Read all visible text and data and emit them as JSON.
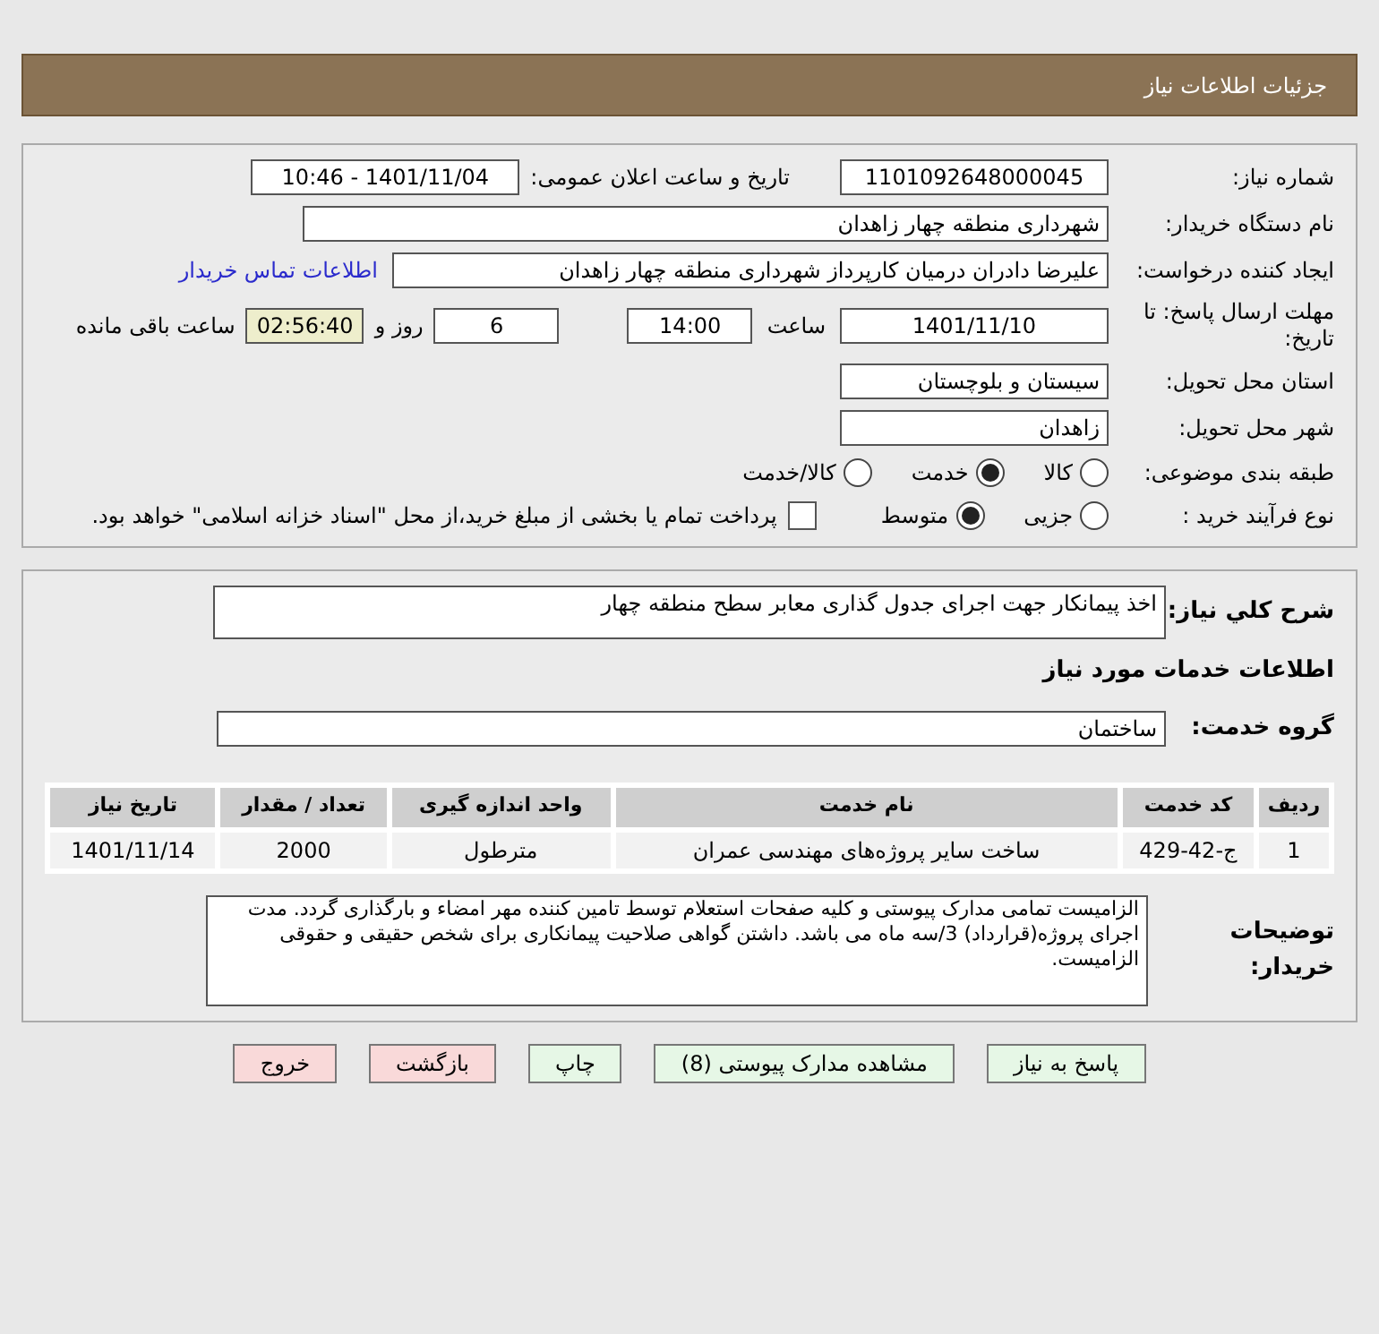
{
  "header": {
    "title": "جزئیات اطلاعات نیاز"
  },
  "info": {
    "need_number": {
      "label": "شماره نیاز:",
      "value": "1101092648000045"
    },
    "announce": {
      "label": "تاریخ و ساعت اعلان عمومی:",
      "value": "1401/11/04 - 10:46"
    },
    "buyer_org": {
      "label": "نام دستگاه خریدار:",
      "value": "شهرداری منطقه چهار زاهدان"
    },
    "requester": {
      "label": "ایجاد کننده درخواست:",
      "value": "علیرضا دادران درمیان کارپرداز شهرداری منطقه چهار زاهدان",
      "link": "اطلاعات تماس خریدار"
    },
    "deadline": {
      "label": "مهلت ارسال پاسخ: تا تاریخ:",
      "date": "1401/11/10",
      "time_label": "ساعت",
      "time": "14:00",
      "days": "6",
      "days_label": "روز و",
      "remaining": "02:56:40",
      "remaining_label": "ساعت باقی مانده"
    },
    "province": {
      "label": "استان محل تحویل:",
      "value": "سیستان و بلوچستان"
    },
    "city": {
      "label": "شهر محل تحویل:",
      "value": "زاهدان"
    },
    "category": {
      "label": "طبقه بندی موضوعی:",
      "options": [
        {
          "label": "کالا",
          "selected": false
        },
        {
          "label": "خدمت",
          "selected": true
        },
        {
          "label": "کالا/خدمت",
          "selected": false
        }
      ]
    },
    "process": {
      "label": "نوع فرآیند خرید :",
      "options": [
        {
          "label": "جزیی",
          "selected": false
        },
        {
          "label": "متوسط",
          "selected": true
        }
      ],
      "checkbox": {
        "checked": false,
        "text": "پرداخت تمام یا بخشی از مبلغ خرید،از محل \"اسناد خزانه اسلامی\" خواهد بود."
      }
    }
  },
  "details": {
    "summary": {
      "label": "شرح کلي نیاز:",
      "value": "اخذ پیمانکار جهت اجرای جدول گذاری معابر سطح منطقه چهار"
    },
    "services_heading": "اطلاعات خدمات مورد نیاز",
    "service_group": {
      "label": "گروه خدمت:",
      "value": "ساختمان"
    },
    "table": {
      "columns": [
        "ردیف",
        "کد خدمت",
        "نام خدمت",
        "واحد اندازه گیری",
        "تعداد / مقدار",
        "تاریخ نیاز"
      ],
      "rows": [
        [
          "1",
          "ج-42-429",
          "ساخت سایر پروژه‌های مهندسی عمران",
          "مترطول",
          "2000",
          "1401/11/14"
        ]
      ]
    },
    "buyer_notes": {
      "label": "توضیحات خریدار:",
      "value": "الزامیست تمامی مدارک پیوستی و کلیه صفحات استعلام توسط تامین کننده مهر امضاء و بارگذاری گردد. مدت اجرای پروژه(قرارداد) 3/سه ماه می باشد. داشتن گواهی صلاحیت پیمانکاری برای شخص حقیقی و حقوقی الزامیست."
    }
  },
  "buttons": [
    {
      "label": "پاسخ به نیاز",
      "kind": "action"
    },
    {
      "label": "مشاهده مدارک پیوستی (8)",
      "kind": "action"
    },
    {
      "label": "چاپ",
      "kind": "action"
    },
    {
      "label": "بازگشت",
      "kind": "danger"
    },
    {
      "label": "خروج",
      "kind": "danger"
    }
  ]
}
